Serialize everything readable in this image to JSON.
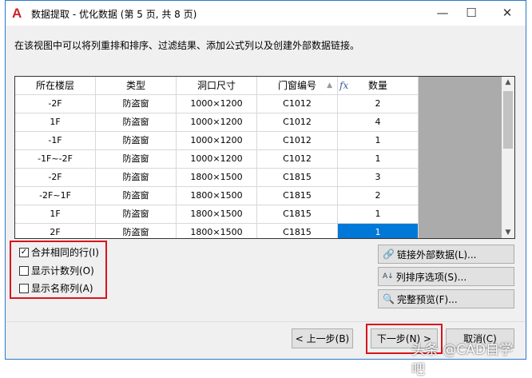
{
  "window": {
    "title": "数据提取 - 优化数据 (第 5 页, 共 8 页)",
    "logo": "A",
    "minimize": "—",
    "maximize": "☐",
    "close": "✕"
  },
  "description": "在该视图中可以将列重排和排序、过滤结果、添加公式列以及创建外部数据链接。",
  "table": {
    "columns": [
      "所在楼层",
      "类型",
      "洞口尺寸",
      "门窗编号",
      "数量"
    ],
    "sort_icon": "▲",
    "formula_icon": "fx",
    "rows": [
      [
        "-2F",
        "防盗窗",
        "1000×1200",
        "C1012",
        "2"
      ],
      [
        "1F",
        "防盗窗",
        "1000×1200",
        "C1012",
        "4"
      ],
      [
        "-1F",
        "防盗窗",
        "1000×1200",
        "C1012",
        "1"
      ],
      [
        "-1F~-2F",
        "防盗窗",
        "1000×1200",
        "C1012",
        "1"
      ],
      [
        "-2F",
        "防盗窗",
        "1800×1500",
        "C1815",
        "3"
      ],
      [
        "-2F~1F",
        "防盗窗",
        "1800×1500",
        "C1815",
        "2"
      ],
      [
        "1F",
        "防盗窗",
        "1800×1500",
        "C1815",
        "1"
      ],
      [
        "2F",
        "防盗窗",
        "1800×1500",
        "C1815",
        "1"
      ]
    ]
  },
  "options": [
    {
      "label": "合并相同的行(I)",
      "checked": true
    },
    {
      "label": "显示计数列(O)",
      "checked": false
    },
    {
      "label": "显示名称列(A)",
      "checked": false
    }
  ],
  "side_buttons": [
    "链接外部数据(L)...",
    "列排序选项(S)...",
    "完整预览(F)..."
  ],
  "nav": {
    "back": "< 上一步(B)",
    "next": "下一步(N) >",
    "cancel": "取消(C)"
  },
  "watermark": "头条 @CAD自学吧"
}
